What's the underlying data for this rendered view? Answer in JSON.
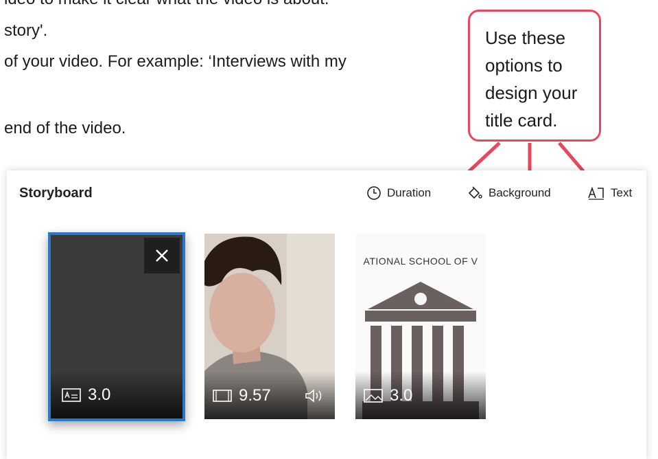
{
  "document": {
    "lines": [
      "ideo to make it clear what the video is about.",
      "story'.",
      "of your video. For example: ‘Interviews with my",
      "end of the video."
    ]
  },
  "callout": {
    "lines": [
      "Use these",
      "options to",
      "design your",
      "title card."
    ],
    "border_color": "#e8475c"
  },
  "storyboard": {
    "title": "Storyboard",
    "tools": {
      "duration": "Duration",
      "background": "Background",
      "text": "Text"
    },
    "cards": [
      {
        "type": "title-card",
        "duration": "3.0",
        "selected": true,
        "icon": "title-card-icon"
      },
      {
        "type": "video",
        "duration": "9.57",
        "icon": "video-icon",
        "audio_icon": "speaker-icon"
      },
      {
        "type": "image",
        "duration": "3.0",
        "icon": "image-icon",
        "banner": "ATIONAL SCHOOL OF V"
      }
    ],
    "accent": "#2c78c8"
  }
}
